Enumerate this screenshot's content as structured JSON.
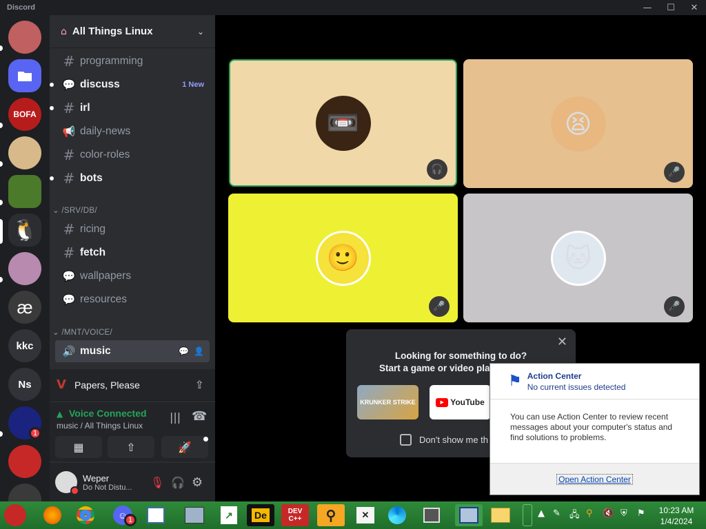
{
  "app": {
    "title": "Discord"
  },
  "window_controls": {
    "minimize": "—",
    "maximize": "☐",
    "close": "✕"
  },
  "servers": [
    {
      "label": "",
      "bg": "#c06060"
    },
    {
      "label": "",
      "bg": "#5865f2"
    },
    {
      "label": "BOFA",
      "bg": "#b71c1c"
    },
    {
      "label": "",
      "bg": "#d8b98a"
    },
    {
      "label": "",
      "bg": "#4a7a2a"
    },
    {
      "label": "",
      "bg": "#2b2d31"
    },
    {
      "label": "",
      "bg": "#b88ab0"
    },
    {
      "label": "æ",
      "bg": "#3a3a3a"
    },
    {
      "label": "kkc",
      "bg": "#313338"
    },
    {
      "label": "Ns",
      "bg": "#313338"
    },
    {
      "label": "",
      "bg": "#1a237e",
      "badge": "1"
    },
    {
      "label": "",
      "bg": "#c62828"
    }
  ],
  "guild": {
    "name": "All Things Linux"
  },
  "channels": [
    {
      "name": "programming",
      "icon": "#",
      "state": "normal"
    },
    {
      "name": "discuss",
      "icon": "forum",
      "state": "unread",
      "tag": "1 New"
    },
    {
      "name": "irl",
      "icon": "#",
      "state": "unread"
    },
    {
      "name": "daily-news",
      "icon": "announce",
      "state": "normal"
    },
    {
      "name": "color-roles",
      "icon": "#",
      "state": "normal"
    },
    {
      "name": "bots",
      "icon": "#",
      "state": "unread"
    }
  ],
  "category_db": {
    "name": "/SRV/DB/"
  },
  "channels_db": [
    {
      "name": "ricing",
      "icon": "#",
      "state": "normal"
    },
    {
      "name": "fetch",
      "icon": "#",
      "state": "unread"
    },
    {
      "name": "wallpapers",
      "icon": "forum",
      "state": "normal"
    },
    {
      "name": "resources",
      "icon": "forum",
      "state": "normal"
    }
  ],
  "category_voice": {
    "name": "/MNT/VOICE/"
  },
  "voice_channel": {
    "name": "music"
  },
  "activity": {
    "name": "Papers, Please"
  },
  "voice_status": {
    "title": "Voice Connected",
    "location": "music / All Things Linux"
  },
  "user": {
    "name": "Weper",
    "status": "Do Not Distu..."
  },
  "tiles": [
    {
      "bg": "#f0d8a8",
      "avatar_bg": "#3a2414",
      "glyph": "📼"
    },
    {
      "bg": "#e6c08f",
      "avatar_bg": "#e8b880",
      "glyph": "😫"
    },
    {
      "bg": "#eef034",
      "avatar_bg": "#f5e23a",
      "glyph": "🙂"
    },
    {
      "bg": "#c8c5c8",
      "avatar_bg": "#dfe8ef",
      "glyph": "🐱"
    }
  ],
  "popup": {
    "title": "Looking for something to do?",
    "subtitle": "Start a game or video playl",
    "game1": "KRUNKER STRIKE",
    "game2": "YouTube",
    "checkbox": "Don't show me th",
    "close": "✕"
  },
  "action_center": {
    "title": "Action Center",
    "status": "No current issues detected",
    "body": "You can use Action Center to review recent messages about your computer's status and find solutions to problems.",
    "link": "Open Action Center"
  },
  "taskbar": {
    "apps": [
      "ornament",
      "firefox",
      "chrome",
      "discord",
      "notepad",
      "photos",
      "charts",
      "De",
      "DEV C++",
      "search",
      "excel",
      "edge",
      "windows",
      "remote",
      "explorer"
    ],
    "discord_badge": "1",
    "devcpp_label": "DEV C++",
    "de_label": "De",
    "youtube_label": "YouTube",
    "time": "10:23 AM",
    "date": "1/4/2024"
  },
  "colors": {
    "accent": "#5865f2",
    "green": "#23a55a",
    "red": "#f23f43",
    "taskbar": "#2f8a3a"
  }
}
